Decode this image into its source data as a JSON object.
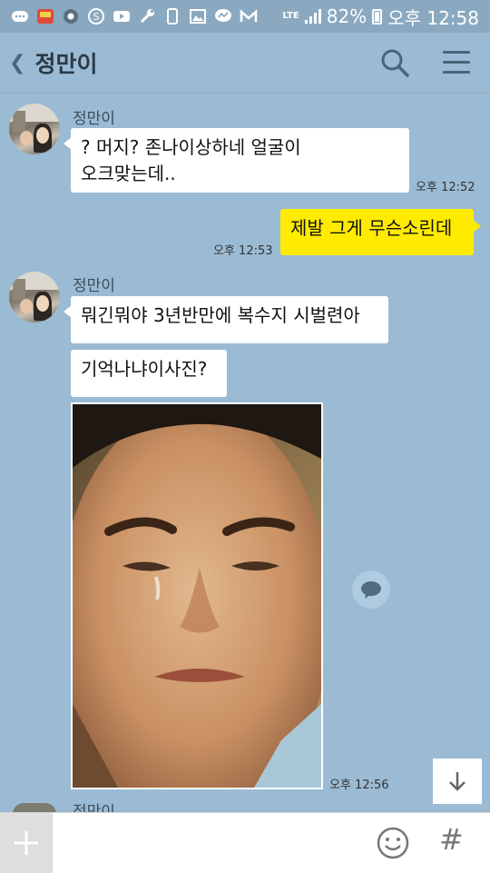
{
  "status_bar": {
    "network": "LTE",
    "battery": "82%",
    "time": "오후 12:58",
    "icons": [
      "chat-icon",
      "app-icon",
      "record-icon",
      "s-icon",
      "youtube-icon",
      "wrench-icon",
      "phone-outline-icon",
      "gallery-icon",
      "messenger-icon",
      "gmail-icon"
    ]
  },
  "header": {
    "back_icon": "chevron-left-icon",
    "title": "정만이",
    "search_icon": "search-icon",
    "menu_icon": "menu-icon"
  },
  "messages": [
    {
      "sender": "정만이",
      "text_lines": [
        "? 머지? 존나이상하네 얼굴이",
        "오크맞는데.."
      ],
      "time": "오후 12:52"
    },
    {
      "mine": true,
      "text": "제발 그게 무슨소린데",
      "time": "오후 12:53"
    },
    {
      "sender": "정만이",
      "text": "뭐긴뭐야 3년반만에 복수지 시벌련아"
    },
    {
      "text": "기억나냐이사진?"
    },
    {
      "photo": "crying-man-photo",
      "time": "오후 12:56"
    }
  ],
  "next_sender": "정만이",
  "input_bar": {
    "plus_icon": "plus-icon",
    "emoji_icon": "emoji-icon",
    "hash_label": "#"
  },
  "colors": {
    "background": "#9bbbd4",
    "my_bubble": "#ffeb00",
    "their_bubble": "#ffffff"
  }
}
